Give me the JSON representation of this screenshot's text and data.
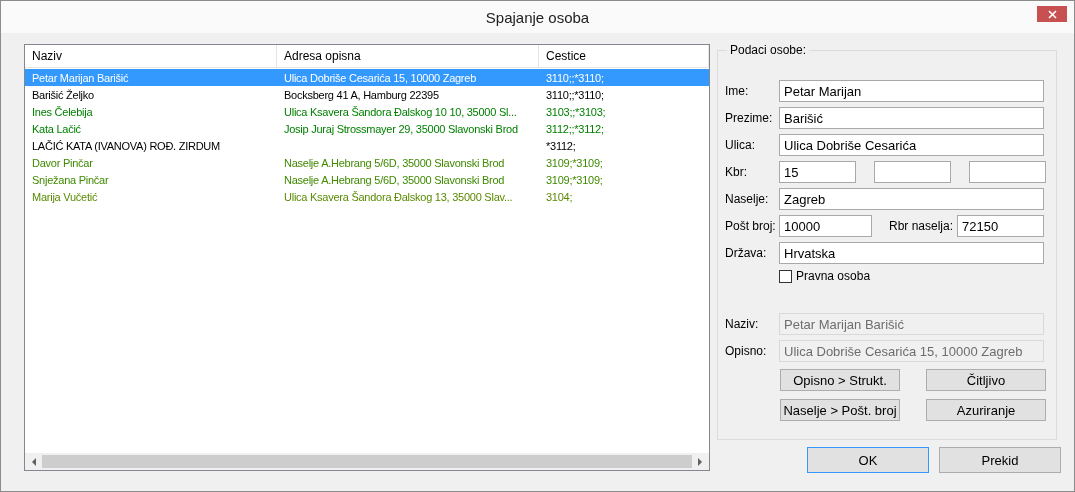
{
  "window": {
    "title": "Spajanje osoba"
  },
  "list": {
    "columns": [
      "Naziv",
      "Adresa opisna",
      "Cestice"
    ],
    "rows": [
      {
        "cells": [
          "Petar Marijan Barišić",
          "Ulica Dobriše Cesarića 15, 10000 Zagreb",
          "3110;;*3110;"
        ],
        "selected": true
      },
      {
        "cells": [
          "Barišić Željko",
          "Bocksberg 41 A, Hamburg 22395",
          "3110;;*3110;"
        ],
        "selected": false,
        "color": "#000000"
      },
      {
        "cells": [
          "Ines Čelebija",
          "Ulica Ksavera Šandora Đalskog 10 10, 35000 Sl...",
          "3103;;*3103;"
        ],
        "selected": false,
        "color": "#008000"
      },
      {
        "cells": [
          "Kata Lačić",
          "Josip Juraj Strossmayer 29, 35000 Slavonski Brod",
          "3112;;*3112;"
        ],
        "selected": false,
        "color": "#008000"
      },
      {
        "cells": [
          "LAČIĆ KATA (IVANOVA) ROĐ. ZIRDUM",
          "",
          "*3112;"
        ],
        "selected": false,
        "color": "#000000"
      },
      {
        "cells": [
          "Davor Pinčar",
          "Naselje A.Hebrang 5/6D, 35000 Slavonski Brod",
          "3109;*3109;"
        ],
        "selected": false,
        "color": "#3f8a00"
      },
      {
        "cells": [
          "Snježana Pinčar",
          "Naselje A.Hebrang 5/6D, 35000 Slavonski Brod",
          "3109;*3109;"
        ],
        "selected": false,
        "color": "#3f8a00"
      },
      {
        "cells": [
          "Marija Vučetić",
          "Ulica Ksavera Šandora Đalskog 13, 35000 Slav...",
          "3104;"
        ],
        "selected": false,
        "color": "#5a8a00"
      }
    ]
  },
  "person": {
    "legend": "Podaci osobe:",
    "ime": {
      "label": "Ime:",
      "value": "Petar Marijan"
    },
    "prezime": {
      "label": "Prezime:",
      "value": "Barišić"
    },
    "ulica": {
      "label": "Ulica:",
      "value": "Ulica Dobriše Cesarića"
    },
    "kbr": {
      "label": "Kbr:",
      "fields": [
        {
          "kind": "text",
          "value": "15"
        },
        {
          "kind": "empty"
        },
        {
          "kind": "empty"
        }
      ]
    },
    "naselje": {
      "label": "Naselje:",
      "value": "Zagreb"
    },
    "post_broj": {
      "label": "Pošt broj:",
      "value": "10000"
    },
    "rbr_naselja": {
      "label": "Rbr naselja:",
      "value": "72150"
    },
    "drzava": {
      "label": "Država:",
      "value": "Hrvatska"
    },
    "pravna_osoba": {
      "label": "Pravna osoba",
      "checked": false
    },
    "naziv": {
      "label": "Naziv:",
      "value": "Petar Marijan Barišić",
      "disabled": true
    },
    "opisno": {
      "label": "Opisno:",
      "value": "Ulica Dobriše Cesarića 15, 10000 Zagreb",
      "disabled": true
    },
    "buttons": [
      "Opisno > Strukt.",
      "Čitljivo",
      "Naselje > Pošt. broj",
      "Azuriranje"
    ]
  },
  "dialog_buttons": [
    {
      "label": "OK",
      "default": true
    },
    {
      "label": "Prekid",
      "default": false
    }
  ]
}
